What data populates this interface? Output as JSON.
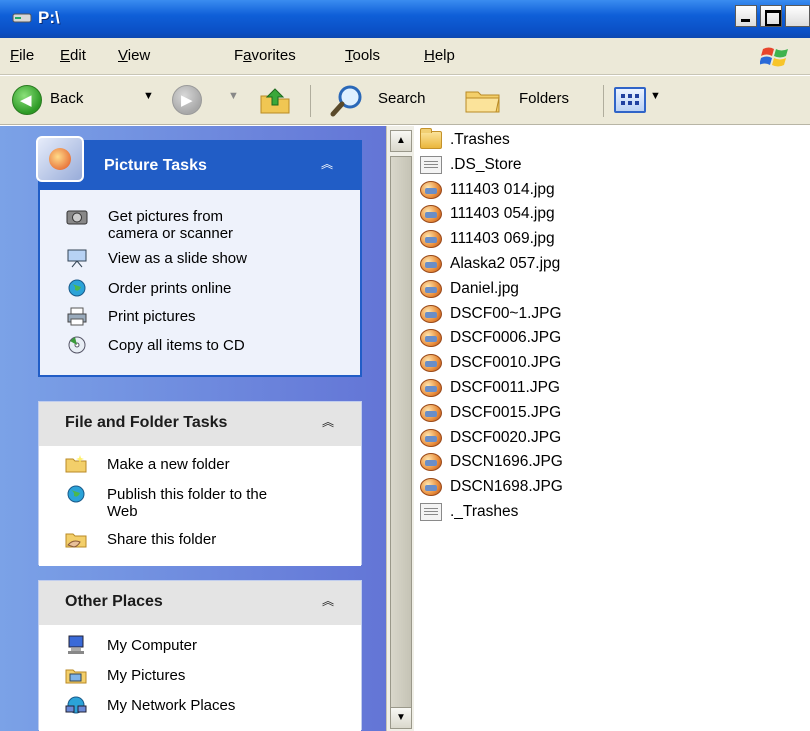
{
  "window": {
    "title": "P:\\"
  },
  "menu": [
    {
      "label": "File",
      "accel": "F",
      "rest": "ile"
    },
    {
      "label": "Edit",
      "accel": "E",
      "rest": "dit"
    },
    {
      "label": "View",
      "accel": "V",
      "rest": "iew"
    },
    {
      "label": "Favorites",
      "pre": "F",
      "accel": "a",
      "rest": "vorites"
    },
    {
      "label": "Tools",
      "accel": "T",
      "rest": "ools"
    },
    {
      "label": "Help",
      "accel": "H",
      "rest": "elp"
    }
  ],
  "toolbar": {
    "back": "Back",
    "search": "Search",
    "folders": "Folders"
  },
  "tasks": {
    "picture": {
      "title": "Picture Tasks",
      "items": [
        {
          "label1": "Get pictures from",
          "label2": "camera or scanner",
          "icon": "camera-icon"
        },
        {
          "label": "View as a slide show",
          "icon": "slideshow-icon"
        },
        {
          "label": "Order prints online",
          "icon": "globe-icon"
        },
        {
          "label": "Print pictures",
          "icon": "printer-icon"
        },
        {
          "label": "Copy all items to CD",
          "icon": "cd-icon"
        }
      ]
    },
    "fileFolder": {
      "title": "File and Folder Tasks",
      "items": [
        {
          "label": "Make a new folder",
          "icon": "new-folder-icon"
        },
        {
          "label1": "Publish this folder to the",
          "label2": "Web",
          "icon": "globe-icon"
        },
        {
          "label": "Share this folder",
          "icon": "share-folder-icon"
        }
      ]
    },
    "other": {
      "title": "Other Places",
      "items": [
        {
          "label": "My Computer",
          "icon": "computer-icon"
        },
        {
          "label": "My Pictures",
          "icon": "pictures-folder-icon"
        },
        {
          "label": "My Network Places",
          "icon": "network-icon"
        }
      ]
    }
  },
  "files": [
    {
      "name": ".Trashes",
      "type": "folder"
    },
    {
      "name": ".DS_Store",
      "type": "doc"
    },
    {
      "name": "111403 014.jpg",
      "type": "jpg"
    },
    {
      "name": "111403 054.jpg",
      "type": "jpg"
    },
    {
      "name": "111403 069.jpg",
      "type": "jpg"
    },
    {
      "name": "Alaska2 057.jpg",
      "type": "jpg"
    },
    {
      "name": "Daniel.jpg",
      "type": "jpg"
    },
    {
      "name": "DSCF00~1.JPG",
      "type": "jpg"
    },
    {
      "name": "DSCF0006.JPG",
      "type": "jpg"
    },
    {
      "name": "DSCF0010.JPG",
      "type": "jpg"
    },
    {
      "name": "DSCF0011.JPG",
      "type": "jpg"
    },
    {
      "name": "DSCF0015.JPG",
      "type": "jpg"
    },
    {
      "name": "DSCF0020.JPG",
      "type": "jpg"
    },
    {
      "name": "DSCN1696.JPG",
      "type": "jpg"
    },
    {
      "name": "DSCN1698.JPG",
      "type": "jpg"
    },
    {
      "name": "._Trashes",
      "type": "doc"
    }
  ]
}
